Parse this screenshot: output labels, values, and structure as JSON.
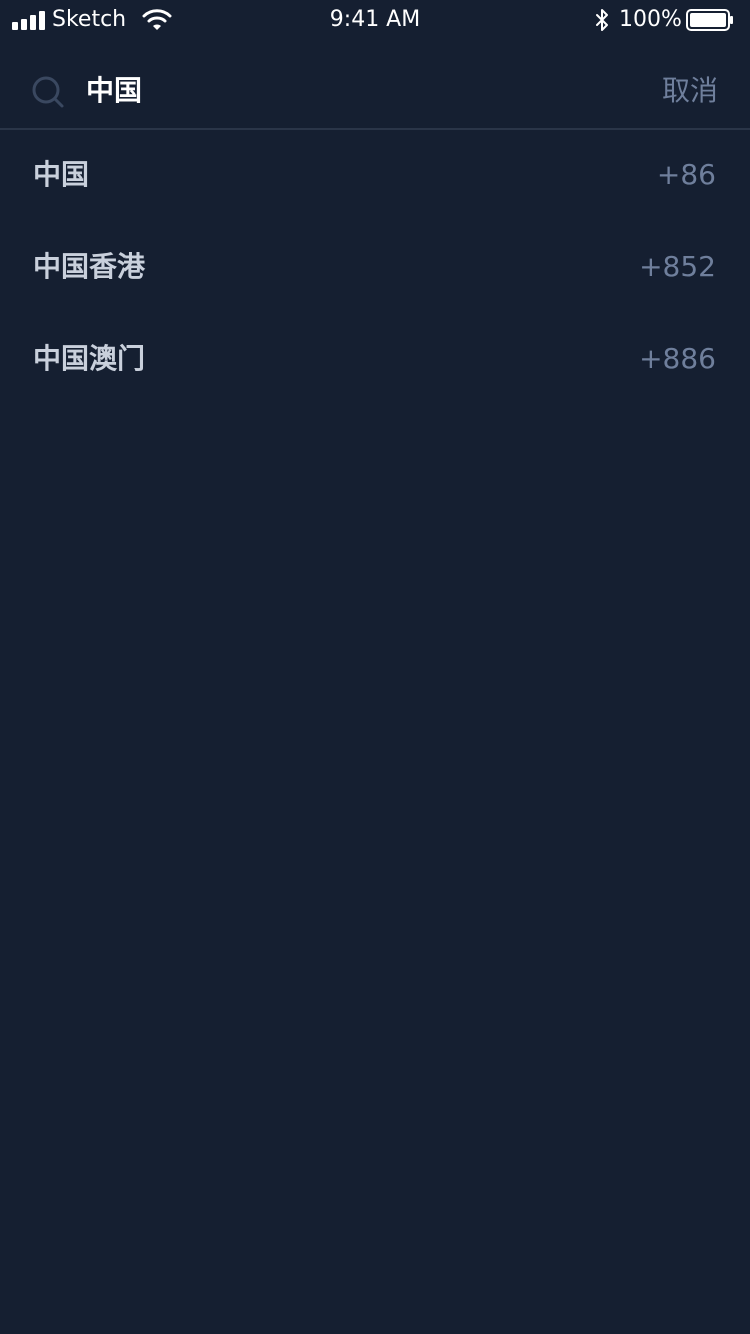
{
  "status_bar": {
    "carrier": "Sketch",
    "time": "9:41 AM",
    "battery_percent": "100%",
    "icons": [
      "signal-icon",
      "wifi-icon",
      "bluetooth-icon",
      "battery-icon"
    ]
  },
  "search": {
    "value": "中国",
    "cancel_label": "取消"
  },
  "results": [
    {
      "name": "中国",
      "code": "+86"
    },
    {
      "name": "中国香港",
      "code": "+852"
    },
    {
      "name": "中国澳门",
      "code": "+886"
    }
  ],
  "colors": {
    "background": "#151f31",
    "primary_text": "#ffffff",
    "list_text": "#c9d0dc",
    "secondary_text": "#6f7f9c",
    "divider": "#2a3548"
  }
}
